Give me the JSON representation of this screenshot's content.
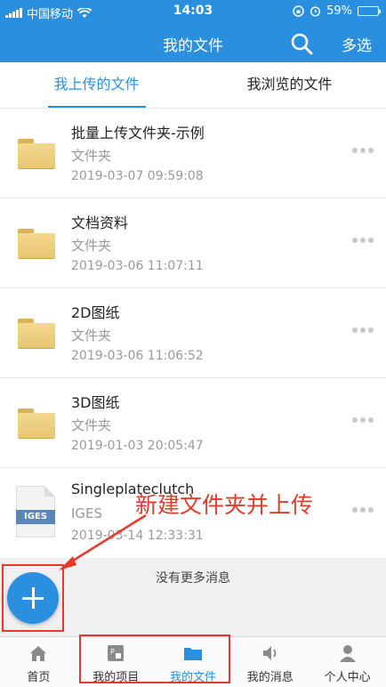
{
  "status_bar": {
    "carrier": "中国移动",
    "time": "14:03",
    "battery": "59%"
  },
  "header": {
    "title": "我的文件",
    "multi_select": "多选",
    "search_icon": "search-icon"
  },
  "tabs": [
    {
      "label": "我上传的文件",
      "active": true
    },
    {
      "label": "我浏览的文件",
      "active": false
    }
  ],
  "files": [
    {
      "name": "批量上传文件夹-示例",
      "kind": "文件夹",
      "date": "2019-03-07 09:59:08",
      "icon": "folder-icon"
    },
    {
      "name": "文档资料",
      "kind": "文件夹",
      "date": "2019-03-06 11:07:11",
      "icon": "folder-icon"
    },
    {
      "name": "2D图纸",
      "kind": "文件夹",
      "date": "2019-03-06 11:06:52",
      "icon": "folder-icon"
    },
    {
      "name": "3D图纸",
      "kind": "文件夹",
      "date": "2019-01-03 20:05:47",
      "icon": "folder-icon"
    },
    {
      "name": "Singleplateclutch",
      "kind": "IGES",
      "date": "2019-03-14 12:33:31",
      "icon": "iges-file-icon",
      "badge": "IGES"
    }
  ],
  "no_more": "没有更多消息",
  "annotation": "新建文件夹并上传",
  "bottom_nav": [
    {
      "label": "首页",
      "icon": "home-icon",
      "active": false
    },
    {
      "label": "我的项目",
      "icon": "project-icon",
      "active": false
    },
    {
      "label": "我的文件",
      "icon": "folder-icon",
      "active": true
    },
    {
      "label": "我的消息",
      "icon": "speaker-icon",
      "active": false
    },
    {
      "label": "个人中心",
      "icon": "user-icon",
      "active": false
    }
  ],
  "colors": {
    "primary": "#2b8fe0",
    "annotation": "#e53a2a"
  }
}
